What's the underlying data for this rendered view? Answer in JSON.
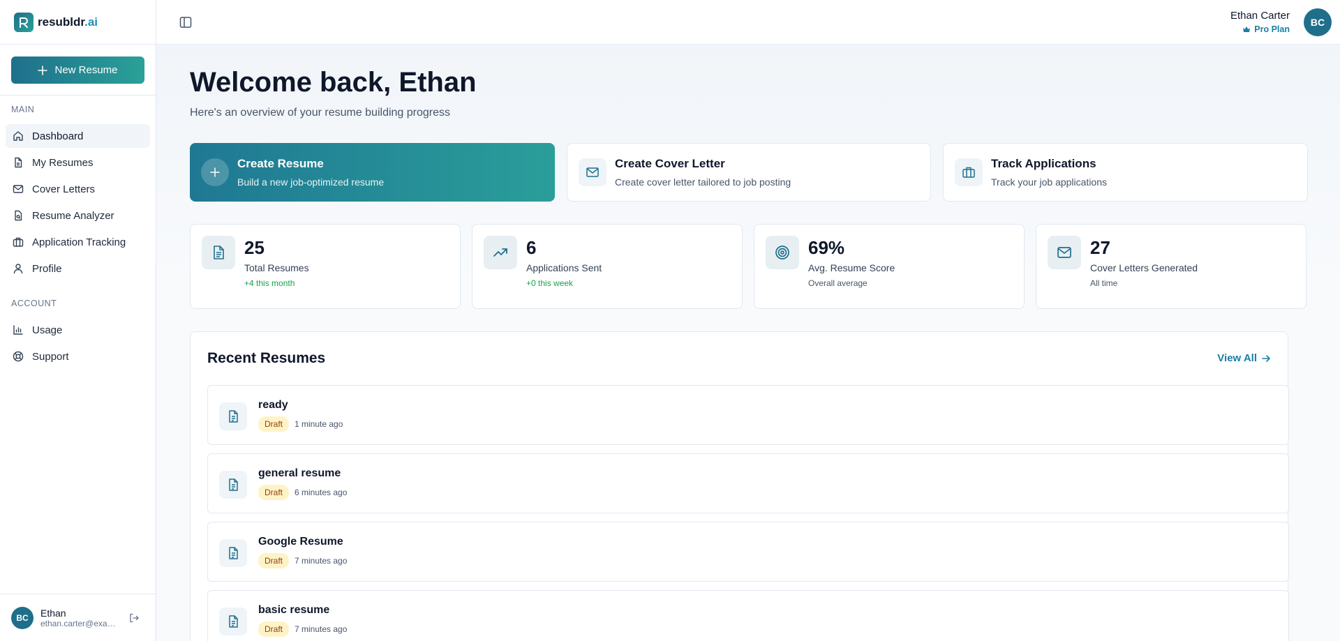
{
  "brand": {
    "name_main": "resubldr",
    "name_accent": ".ai"
  },
  "sidebar": {
    "new_button": "New Resume",
    "main_label": "MAIN",
    "account_label": "ACCOUNT",
    "items": [
      {
        "label": "Dashboard",
        "icon": "home-icon"
      },
      {
        "label": "My Resumes",
        "icon": "document-icon"
      },
      {
        "label": "Cover Letters",
        "icon": "mail-icon"
      },
      {
        "label": "Resume Analyzer",
        "icon": "file-search-icon"
      },
      {
        "label": "Application Tracking",
        "icon": "briefcase-icon"
      },
      {
        "label": "Profile",
        "icon": "user-icon"
      }
    ],
    "account_items": [
      {
        "label": "Usage",
        "icon": "bar-chart-icon"
      },
      {
        "label": "Support",
        "icon": "lifebuoy-icon"
      }
    ],
    "user": {
      "initials": "BC",
      "name": "Ethan",
      "email": "ethan.carter@example.com"
    }
  },
  "header": {
    "user_name": "Ethan Carter",
    "plan": "Pro Plan",
    "initials": "BC"
  },
  "main": {
    "welcome": "Welcome back, Ethan",
    "subtitle": "Here's an overview of your resume building progress",
    "quick_actions": [
      {
        "title": "Create Resume",
        "desc": "Build a new job-optimized resume"
      },
      {
        "title": "Create Cover Letter",
        "desc": "Create cover letter tailored to job posting"
      },
      {
        "title": "Track Applications",
        "desc": "Track your job applications"
      }
    ],
    "stats": [
      {
        "value": "25",
        "label": "Total Resumes",
        "sub": "+4 this month"
      },
      {
        "value": "6",
        "label": "Applications Sent",
        "sub": "+0 this week"
      },
      {
        "value": "69%",
        "label": "Avg. Resume Score",
        "sub": "Overall average"
      },
      {
        "value": "27",
        "label": "Cover Letters Generated",
        "sub": "All time"
      }
    ],
    "recent": {
      "title": "Recent Resumes",
      "view_all": "View All",
      "items": [
        {
          "name": "ready",
          "status": "Draft",
          "time": "1 minute ago"
        },
        {
          "name": "general resume",
          "status": "Draft",
          "time": "6 minutes ago"
        },
        {
          "name": "Google Resume",
          "status": "Draft",
          "time": "7 minutes ago"
        },
        {
          "name": "basic resume",
          "status": "Draft",
          "time": "7 minutes ago"
        }
      ]
    }
  },
  "colors": {
    "brand": "#1f6f8b",
    "accent": "#2aa198",
    "positive": "#16a34a",
    "draft_badge": "#fef3c7"
  }
}
